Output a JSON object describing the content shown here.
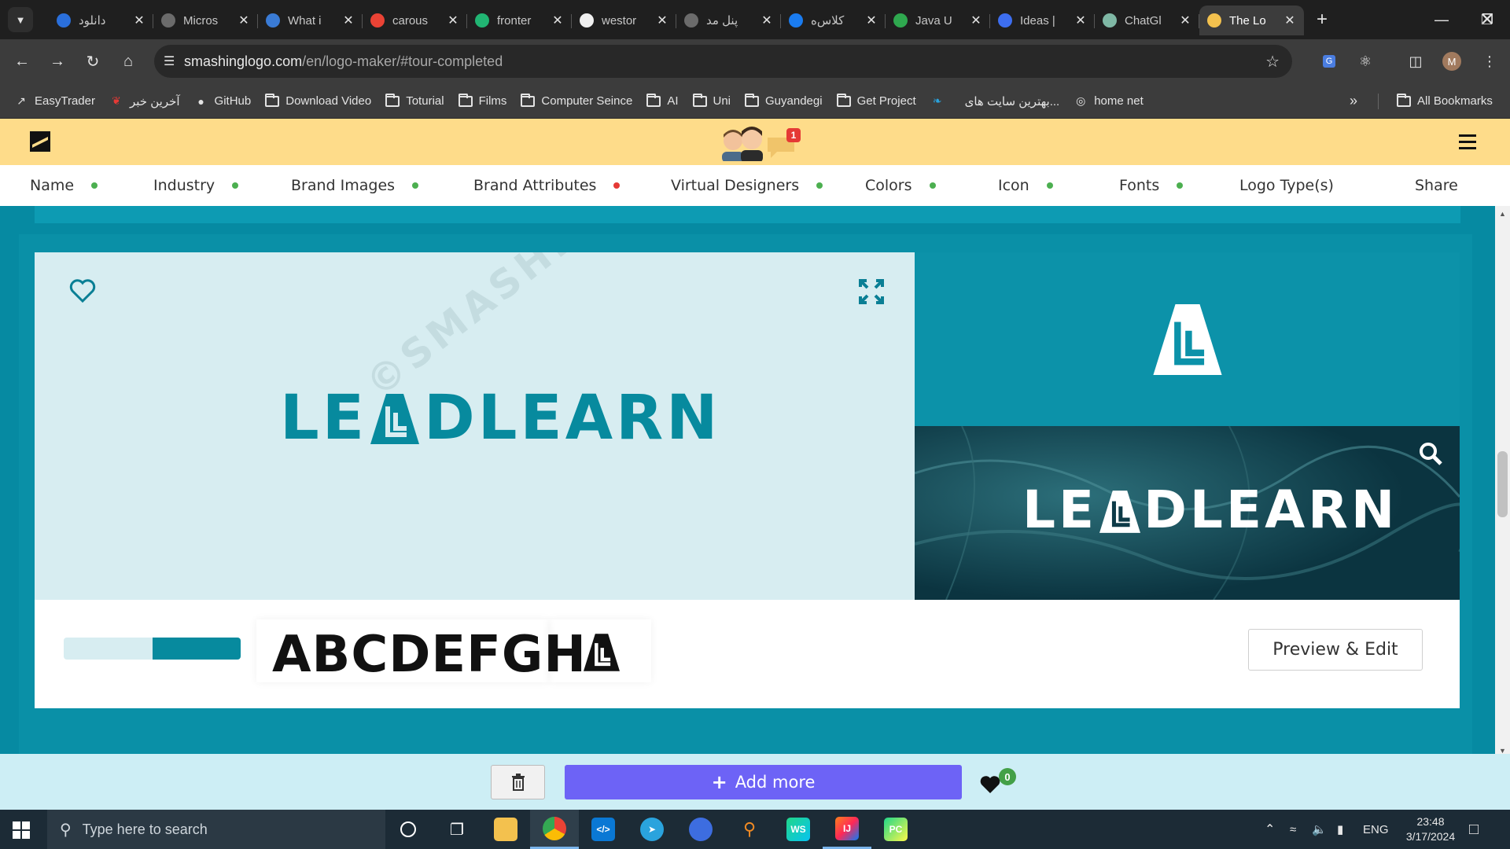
{
  "browser": {
    "tabs": [
      {
        "title": "دانلود",
        "favicon_color": "#2a6fdb"
      },
      {
        "title": "Micros",
        "favicon_color": "#6b6b6b"
      },
      {
        "title": "What i",
        "favicon_color": "#3a7bd5"
      },
      {
        "title": "carous",
        "favicon_color": "#ea4335"
      },
      {
        "title": "fronter",
        "favicon_color": "#21b573"
      },
      {
        "title": "westor",
        "favicon_color": "#f0f0f0"
      },
      {
        "title": "پنل مد",
        "favicon_color": "#6b6b6b"
      },
      {
        "title": "کلاس‌ه",
        "favicon_color": "#1a7cf0"
      },
      {
        "title": "Java U",
        "favicon_color": "#2fa84f"
      },
      {
        "title": "Ideas |",
        "favicon_color": "#3d6ef0"
      },
      {
        "title": "ChatGl",
        "favicon_color": "#7fb8a5"
      },
      {
        "title": "The Lo",
        "favicon_color": "#f3c14e",
        "active": true
      }
    ],
    "url_host": "smashinglogo.com",
    "url_path": "/en/logo-maker/#tour-completed",
    "profile_initial": "M",
    "bookmarks": [
      {
        "label": "EasyTrader",
        "icon": "chart-icon"
      },
      {
        "label": "آخرین خبر",
        "icon": "news-icon"
      },
      {
        "label": "GitHub",
        "icon": "github-icon"
      },
      {
        "label": "Download Video",
        "icon": "folder-icon"
      },
      {
        "label": "Toturial",
        "icon": "folder-icon"
      },
      {
        "label": "Films",
        "icon": "folder-icon"
      },
      {
        "label": "Computer Seince",
        "icon": "folder-icon"
      },
      {
        "label": "AI",
        "icon": "folder-icon"
      },
      {
        "label": "Uni",
        "icon": "folder-icon"
      },
      {
        "label": "Guyandegi",
        "icon": "folder-icon"
      },
      {
        "label": "Get Project",
        "icon": "folder-icon"
      },
      {
        "label": "",
        "icon": "feather-icon"
      },
      {
        "label": "بهترین سایت های...",
        "icon": "none"
      },
      {
        "label": "home net",
        "icon": "globe-icon"
      }
    ],
    "all_bookmarks_label": "All Bookmarks"
  },
  "site": {
    "notification_count": "1",
    "steps": [
      {
        "label": "Name",
        "status": "done",
        "color": "#4caf50"
      },
      {
        "label": "Industry",
        "status": "done",
        "color": "#4caf50"
      },
      {
        "label": "Brand Images",
        "status": "done",
        "color": "#4caf50"
      },
      {
        "label": "Brand Attributes",
        "status": "incomplete",
        "color": "#e53935"
      },
      {
        "label": "Virtual Designers",
        "status": "done",
        "color": "#4caf50"
      },
      {
        "label": "Colors",
        "status": "done",
        "color": "#4caf50"
      },
      {
        "label": "Icon",
        "status": "done",
        "color": "#4caf50"
      },
      {
        "label": "Fonts",
        "status": "done",
        "color": "#4caf50"
      },
      {
        "label": "Logo Type(s)",
        "status": "none",
        "color": ""
      },
      {
        "label": "Share",
        "status": "none",
        "color": ""
      }
    ],
    "logo": {
      "name_part1": "LE",
      "name_part2": "DLEARN",
      "watermark": "©SMASHINGLOGO",
      "font_sample": "ABCDEFGH",
      "brand_color": "#078a9e",
      "palette": [
        "#d7edf1",
        "#078a9e"
      ]
    },
    "preview_edit_label": "Preview & Edit",
    "add_more_label": "Add more",
    "favorites_count": "0"
  },
  "taskbar": {
    "search_placeholder": "Type here to search",
    "language": "ENG",
    "time": "23:48",
    "date": "3/17/2024"
  }
}
